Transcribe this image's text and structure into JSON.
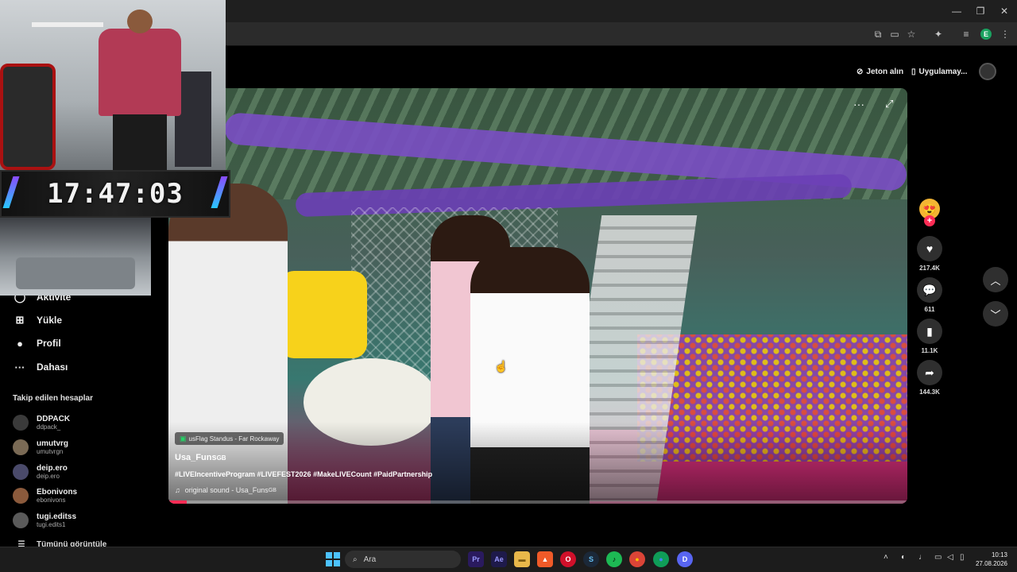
{
  "browser": {
    "window_controls": {
      "minimize": "—",
      "maximize": "❐",
      "close": "✕"
    },
    "toolbar_icons": [
      "translate-icon",
      "cast-icon",
      "star-icon",
      "extensions-icon",
      "media-icon",
      "profile-icon",
      "menu-icon"
    ],
    "profile_initial": "E"
  },
  "header": {
    "coins_label": "Jeton alın",
    "app_label": "Uygulamay..."
  },
  "overlay": {
    "clock": "17:47:03"
  },
  "sidebar": {
    "items": [
      {
        "label": "Aktivite",
        "icon": "activity-icon",
        "glyph": "◯"
      },
      {
        "label": "Yükle",
        "icon": "upload-icon",
        "glyph": "⊞"
      },
      {
        "label": "Profil",
        "icon": "profile-icon",
        "glyph": "●"
      },
      {
        "label": "Dahası",
        "icon": "more-icon",
        "glyph": "···"
      }
    ],
    "following_heading": "Takip edilen hesaplar",
    "accounts": [
      {
        "name": "DDPACK",
        "handle": "ddpack_",
        "color": "#3a3a3a"
      },
      {
        "name": "umutvrg",
        "handle": "umutvrgn",
        "color": "#7a6a55"
      },
      {
        "name": "deip.ero",
        "handle": "deip.ero",
        "color": "#4a4a6a"
      },
      {
        "name": "Ebonivons",
        "handle": "ebonivons",
        "color": "#8b5a3c"
      },
      {
        "name": "tugi.editss",
        "handle": "tugi.edits1",
        "color": "#5a5a5a"
      }
    ],
    "see_all": "Tümünü görüntüle"
  },
  "video": {
    "location": "usFlag Standus - Far Rockaway",
    "username": "Usa_Funs",
    "username_suffix": "GB",
    "caption": "#LIVEIncentiveProgram #LIVEFEST2026 #MakeLIVECount #PaidPartnership",
    "sound": "original sound - Usa_Funs",
    "sound_suffix": "GB",
    "progress": 0.025
  },
  "actions": {
    "likes": "217.4K",
    "comments": "611",
    "saves": "11.1K",
    "shares": "144.3K"
  },
  "taskbar": {
    "search_placeholder": "Ara",
    "apps": [
      {
        "name": "premiere-icon",
        "label": "Pr",
        "bg": "#2a1a5e",
        "fg": "#9999ff"
      },
      {
        "name": "after-effects-icon",
        "label": "Ae",
        "bg": "#1e1a4a",
        "fg": "#9999ff"
      },
      {
        "name": "folder-icon",
        "label": "▬",
        "bg": "#e8b84a",
        "fg": "#7a5a10"
      },
      {
        "name": "brave-icon",
        "label": "▲",
        "bg": "#f05a28",
        "fg": "#fff"
      },
      {
        "name": "opera-icon",
        "label": "O",
        "bg": "#d0102a",
        "fg": "#fff"
      },
      {
        "name": "steam-icon",
        "label": "S",
        "bg": "#1b2838",
        "fg": "#66c0f4"
      },
      {
        "name": "spotify-icon",
        "label": "♪",
        "bg": "#1db954",
        "fg": "#000"
      },
      {
        "name": "chrome-icon",
        "label": "●",
        "bg": "#db4437",
        "fg": "#fbbc05"
      },
      {
        "name": "chrome-profile-icon",
        "label": "●",
        "bg": "#0f9d58",
        "fg": "#4285f4"
      },
      {
        "name": "discord-icon",
        "label": "D",
        "bg": "#5865f2",
        "fg": "#fff"
      }
    ],
    "time": "10:13",
    "date": "27.08.2026"
  }
}
